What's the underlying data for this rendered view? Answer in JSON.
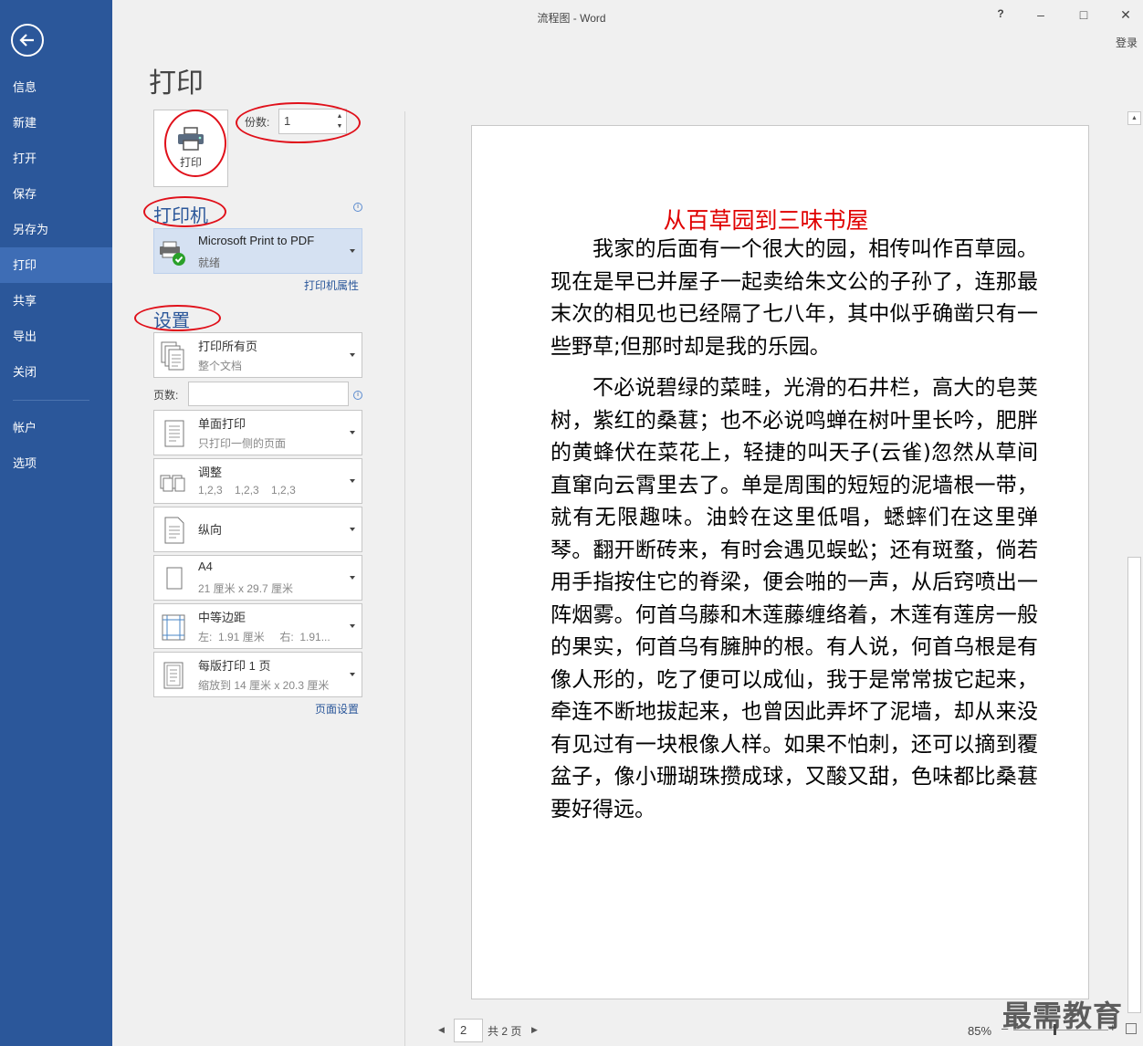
{
  "window": {
    "title": "流程图 - Word",
    "help": "?",
    "minimize": "–",
    "maximize": "□",
    "close": "✕",
    "login": "登录"
  },
  "sidebar": {
    "items": [
      {
        "label": "信息"
      },
      {
        "label": "新建"
      },
      {
        "label": "打开"
      },
      {
        "label": "保存"
      },
      {
        "label": "另存为"
      },
      {
        "label": "打印"
      },
      {
        "label": "共享"
      },
      {
        "label": "导出"
      },
      {
        "label": "关闭"
      },
      {
        "label": "帐户"
      },
      {
        "label": "选项"
      }
    ],
    "active": "打印"
  },
  "print": {
    "heading": "打印",
    "button_label": "打印",
    "copies_label": "份数:",
    "copies_value": "1"
  },
  "printer": {
    "section_title": "打印机",
    "name": "Microsoft Print to PDF",
    "status": "就绪",
    "properties_link": "打印机属性"
  },
  "settings": {
    "section_title": "设置",
    "pages_label": "页数:",
    "pages_value": "",
    "items": [
      {
        "main": "打印所有页",
        "sub": "整个文档"
      },
      {
        "main": "单面打印",
        "sub": "只打印一侧的页面"
      },
      {
        "main": "调整",
        "sub": "1,2,3    1,2,3    1,2,3"
      },
      {
        "main": "纵向",
        "sub": ""
      },
      {
        "main": "A4",
        "sub": "21 厘米 x 29.7 厘米"
      },
      {
        "main": "中等边距",
        "sub": "左:  1.91 厘米     右:  1.91..."
      },
      {
        "main": "每版打印 1 页",
        "sub": "缩放到 14 厘米 x 20.3 厘米"
      }
    ],
    "page_setup_link": "页面设置"
  },
  "preview": {
    "title": "从百草园到三味书屋",
    "paragraphs": [
      "我家的后面有一个很大的园，相传叫作百草园。现在是早已并屋子一起卖给朱文公的子孙了，连那最末次的相见也已经隔了七八年，其中似乎确凿只有一些野草;但那时却是我的乐园。",
      "不必说碧绿的菜畦，光滑的石井栏，高大的皂荚树，紫红的桑葚；也不必说鸣蝉在树叶里长吟，肥胖的黄蜂伏在菜花上，轻捷的叫天子(云雀)忽然从草间直窜向云霄里去了。单是周围的短短的泥墙根一带，就有无限趣味。油蛉在这里低唱，蟋蟀们在这里弹琴。翻开断砖来，有时会遇见蜈蚣；还有斑蝥，倘若用手指按住它的脊梁，便会啪的一声，从后窍喷出一阵烟雾。何首乌藤和木莲藤缠络着，木莲有莲房一般的果实，何首乌有臃肿的根。有人说，何首乌根是有像人形的，吃了便可以成仙，我于是常常拔它起来，牵连不断地拔起来，也曾因此弄坏了泥墙，却从来没有见过有一块根像人样。如果不怕刺，还可以摘到覆盆子，像小珊瑚珠攒成球，又酸又甜，色味都比桑葚要好得远。"
    ]
  },
  "navigation": {
    "current_page": "2",
    "total": "共 2 页",
    "zoom": "85%"
  },
  "watermark": "最需教育",
  "colors": {
    "accent": "#2b579a",
    "sidebar_active": "#3e6db5",
    "doc_title": "#e00000",
    "annotation": "#e0101a"
  }
}
